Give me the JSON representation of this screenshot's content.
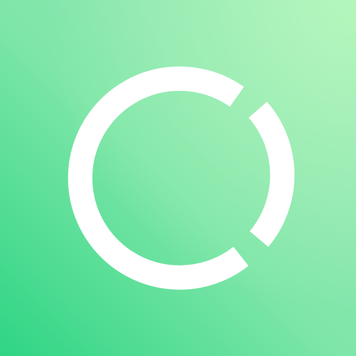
{
  "app_icon": {
    "name": "logo-ring",
    "icon": "split-ring-icon",
    "colors": {
      "gradient_light": "#b4f7bd",
      "gradient_mid": "#7ee6a8",
      "gradient_dark": "#2fd584",
      "mark": "#ffffff"
    }
  }
}
